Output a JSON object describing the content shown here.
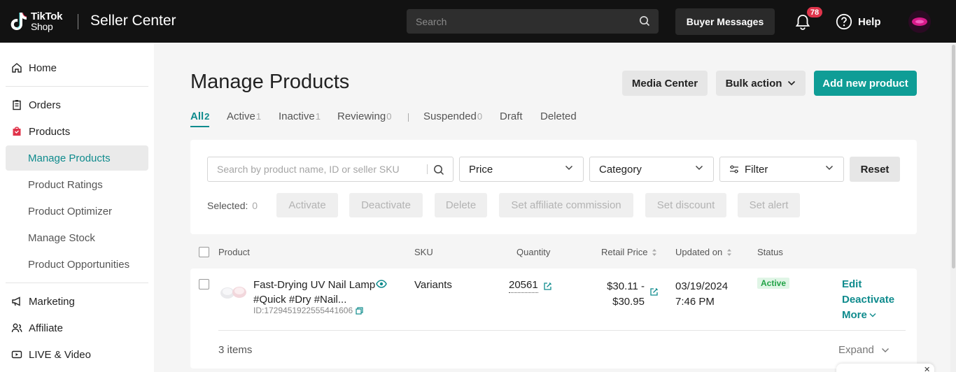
{
  "topbar": {
    "logo_line1": "TikTok",
    "logo_line2": "Shop",
    "app_title": "Seller Center",
    "search_placeholder": "Search",
    "buyer_messages": "Buyer Messages",
    "notification_count": "78",
    "help": "Help",
    "icons": [
      "tiktok-logo",
      "search-icon",
      "bell-icon",
      "help-icon",
      "avatar"
    ]
  },
  "sidebar": {
    "home": "Home",
    "orders": "Orders",
    "products": "Products",
    "manage_products": "Manage Products",
    "product_ratings": "Product Ratings",
    "product_optimizer": "Product Optimizer",
    "manage_stock": "Manage Stock",
    "product_opportunities": "Product Opportunities",
    "marketing": "Marketing",
    "affiliate": "Affiliate",
    "live_video": "LIVE & Video"
  },
  "main": {
    "title": "Manage Products",
    "media_center": "Media Center",
    "bulk_action": "Bulk action",
    "add_new_product": "Add new product",
    "tabs": [
      {
        "label": "All",
        "count": "2"
      },
      {
        "label": "Active",
        "count": "1"
      },
      {
        "label": "Inactive",
        "count": "1"
      },
      {
        "label": "Reviewing",
        "count": "0"
      },
      {
        "label": "Suspended",
        "count": "0"
      },
      {
        "label": "Draft",
        "count": ""
      },
      {
        "label": "Deleted",
        "count": ""
      }
    ],
    "filters": {
      "search_placeholder": "Search by product name, ID or seller SKU",
      "price": "Price",
      "category": "Category",
      "filter": "Filter",
      "reset": "Reset"
    },
    "bulk": {
      "selected_label": "Selected:",
      "selected_count": "0",
      "activate": "Activate",
      "deactivate": "Deactivate",
      "delete": "Delete",
      "set_affiliate": "Set affiliate commission",
      "set_discount": "Set discount",
      "set_alert": "Set alert"
    },
    "table": {
      "columns": {
        "product": "Product",
        "sku": "SKU",
        "quantity": "Quantity",
        "retail_price": "Retail Price",
        "updated_on": "Updated on",
        "status": "Status"
      },
      "rows": [
        {
          "name_line1": "Fast-Drying UV Nail Lamp",
          "name_line2": "#Quick #Dry #Nail...",
          "id": "ID:1729451922555441606",
          "sku": "Variants",
          "quantity": "20561",
          "price_line1": "$30.11 -",
          "price_line2": "$30.95",
          "date": "03/19/2024",
          "time": "7:46 PM",
          "status": "Active",
          "edit": "Edit",
          "deactivate": "Deactivate",
          "more": "More"
        }
      ],
      "items_count": "3 items",
      "expand": "Expand"
    }
  },
  "colors": {
    "accent": "#0f9d96",
    "topbar": "#121212",
    "badge": "#e0344b",
    "active_status": "#22a347"
  }
}
